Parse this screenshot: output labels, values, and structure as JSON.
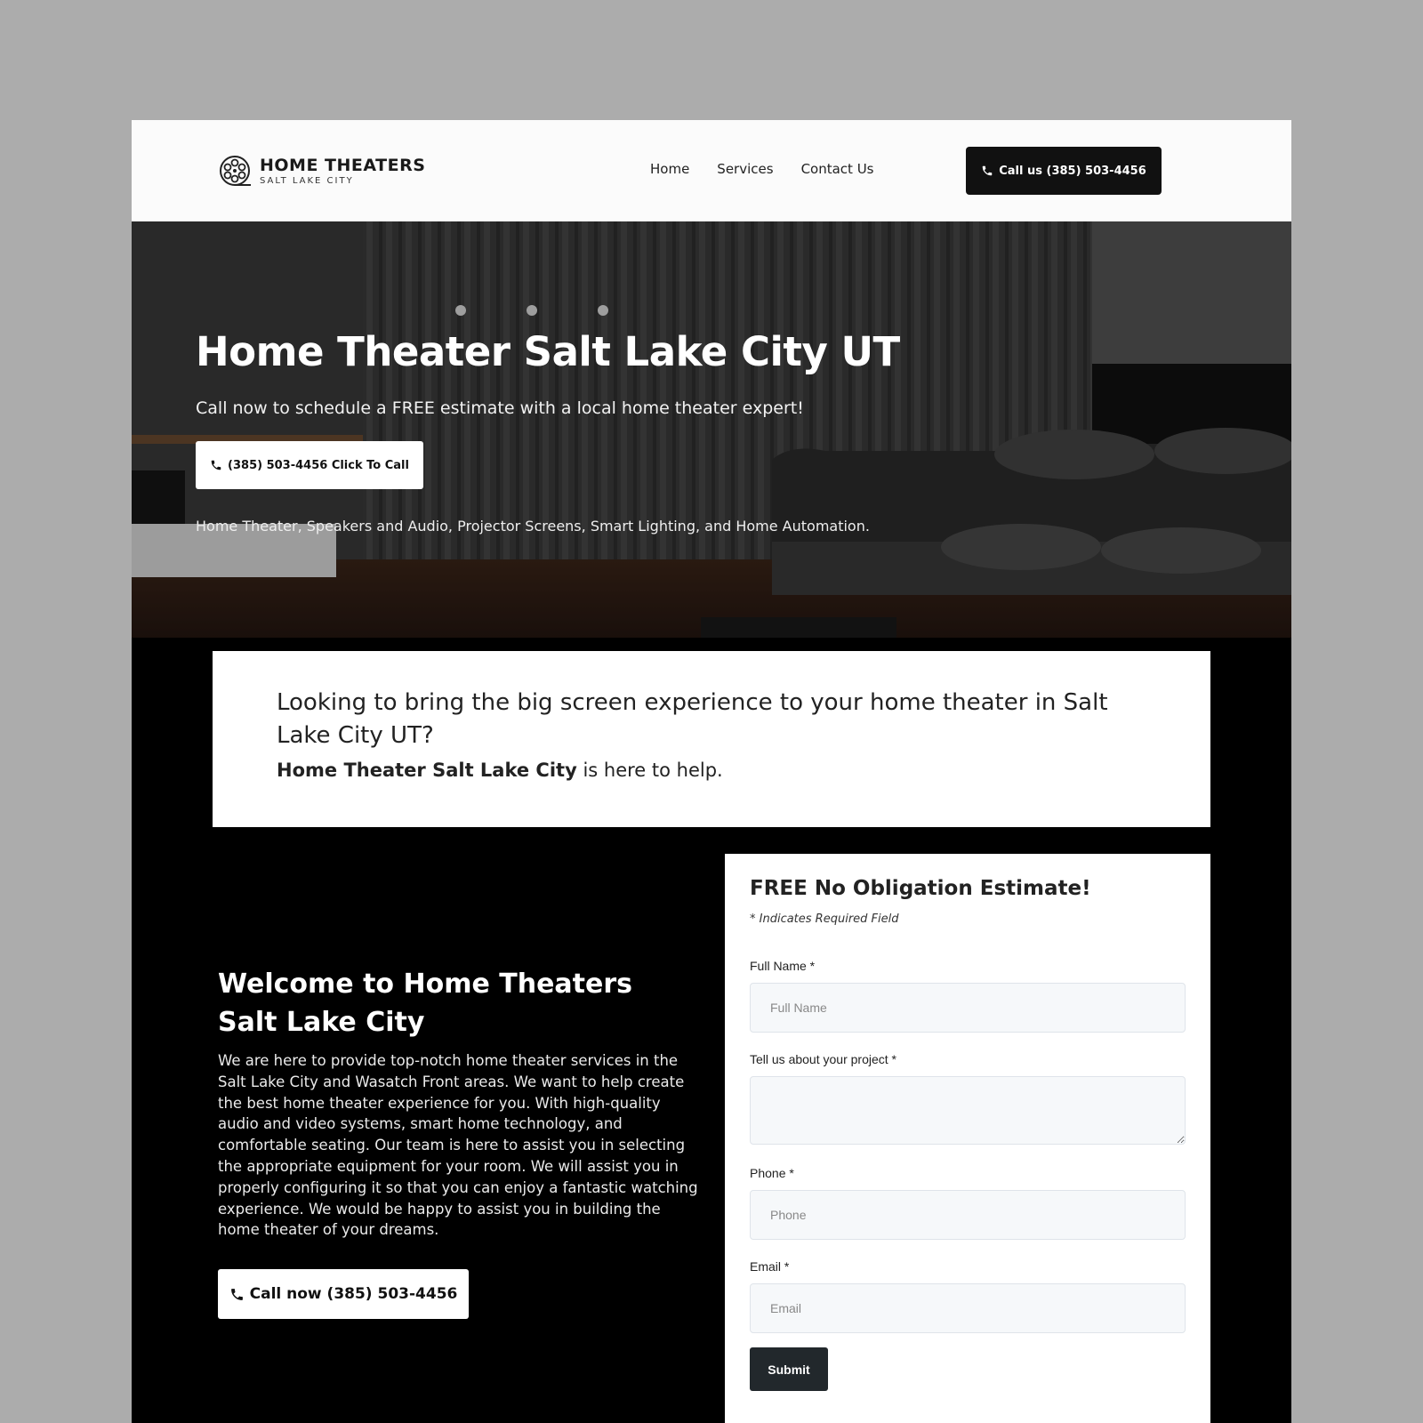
{
  "header": {
    "logo_title": "HOME THEATERS",
    "logo_subtitle": "SALT LAKE CITY",
    "nav": [
      "Home",
      "Services",
      "Contact Us"
    ],
    "cta_label": "Call us (385) 503-4456"
  },
  "hero": {
    "title": "Home Theater Salt Lake City UT",
    "subtitle": "Call now to schedule a FREE estimate with a local home theater expert!",
    "button_label": "(385) 503-4456 Click To Call",
    "services": "Home Theater, Speakers and Audio, Projector Screens, Smart Lighting, and Home Automation."
  },
  "intro": {
    "question": "Looking to bring the big screen experience to your home theater in Salt Lake City UT?",
    "help_bold": "Home Theater Salt Lake City",
    "help_rest": " is here to help."
  },
  "welcome": {
    "title": "Welcome to Home Theaters Salt Lake City",
    "body": "We are here to provide top-notch home theater services in the Salt Lake City and Wasatch Front areas. We want to help create the best home theater experience for you. With high-quality audio and video systems, smart home technology, and comfortable seating. Our team is here to assist you in selecting the appropriate equipment for your room. We will assist you in properly configuring it so that you can enjoy a fantastic watching experience. We would be happy to assist you in building the home theater of your dreams.",
    "button_label": "Call now (385) 503-4456"
  },
  "form": {
    "title": "FREE No Obligation Estimate!",
    "required_note": "* Indicates Required Field",
    "full_name_label": "Full Name *",
    "full_name_placeholder": "Full Name",
    "project_label": "Tell us about your project *",
    "phone_label": "Phone *",
    "phone_placeholder": "Phone",
    "email_label": "Email *",
    "email_placeholder": "Email",
    "submit_label": "Submit"
  },
  "icons": {
    "logo": "film-reel-icon",
    "phone": "phone-icon"
  }
}
